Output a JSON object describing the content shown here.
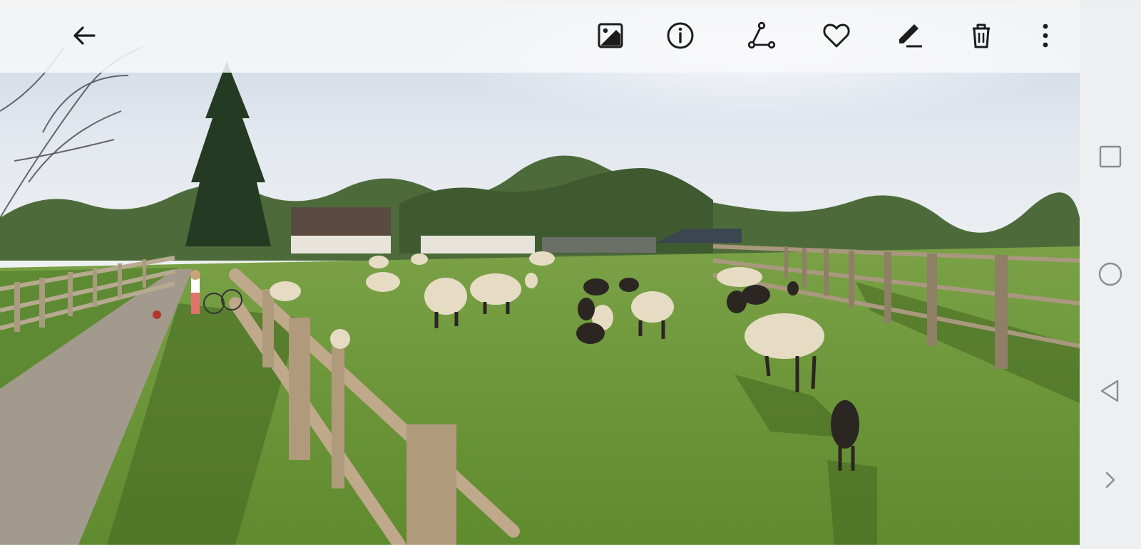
{
  "toolbar": {
    "icons": [
      "back-arrow-icon",
      "image-icon",
      "info-icon",
      "share-icon",
      "heart-icon",
      "edit-icon",
      "trash-icon",
      "more-vert-icon"
    ]
  },
  "navbar": {
    "icons": [
      "recents-square-icon",
      "home-circle-icon",
      "back-triangle-icon",
      "chevron-right-icon"
    ]
  },
  "colors": {
    "icon": "#1c1c1c",
    "nav_icon": "#8a8c90",
    "toolbar_bg": "#f8f8fa",
    "grass": "#6f9a3c",
    "sky": "#dfe6ee"
  }
}
